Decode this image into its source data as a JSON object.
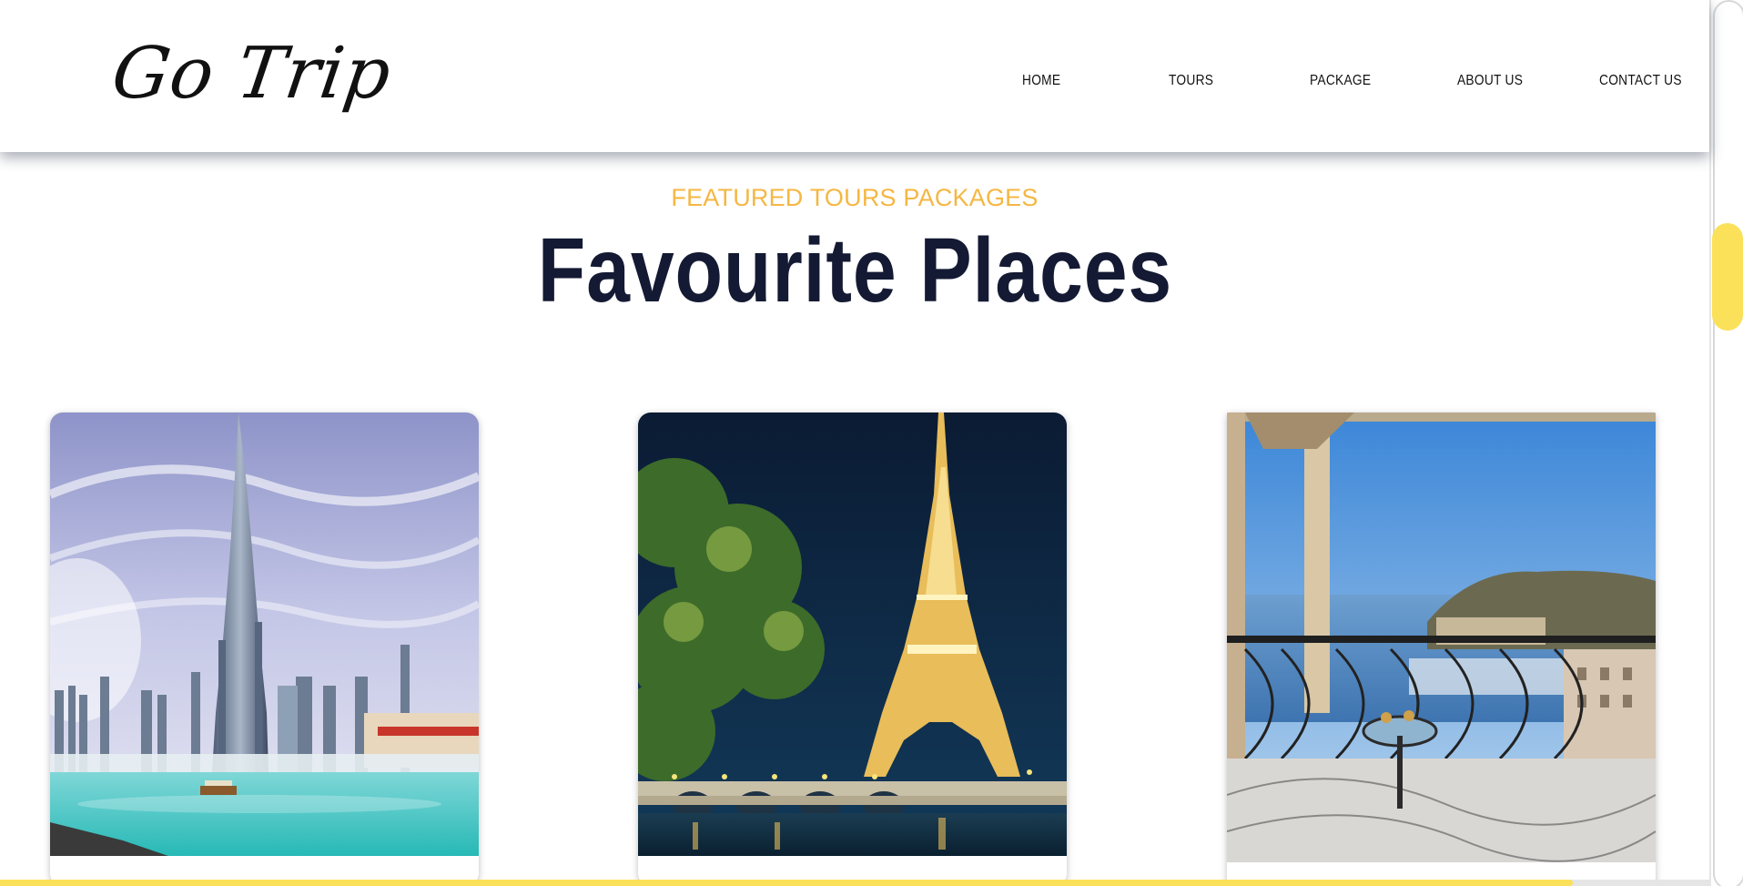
{
  "header": {
    "logo_text": "Go Trip",
    "nav": [
      {
        "label": "HOME"
      },
      {
        "label": "TOURS"
      },
      {
        "label": "PACKAGE"
      },
      {
        "label": "ABOUT US"
      },
      {
        "label": "CONTACT US"
      }
    ]
  },
  "section": {
    "eyebrow": "FEATURED TOURS PACKAGES",
    "title": "Favourite Places"
  },
  "cards": [
    {
      "image": "burj-khalifa-dubai-fountain-image"
    },
    {
      "image": "eiffel-tower-night-image"
    },
    {
      "image": "monaco-balcony-harbor-image"
    }
  ],
  "scroll_progress": 0.92,
  "colors": {
    "accent": "#f5b743",
    "title": "#141a33",
    "scroll_accent": "#fbe15a"
  }
}
